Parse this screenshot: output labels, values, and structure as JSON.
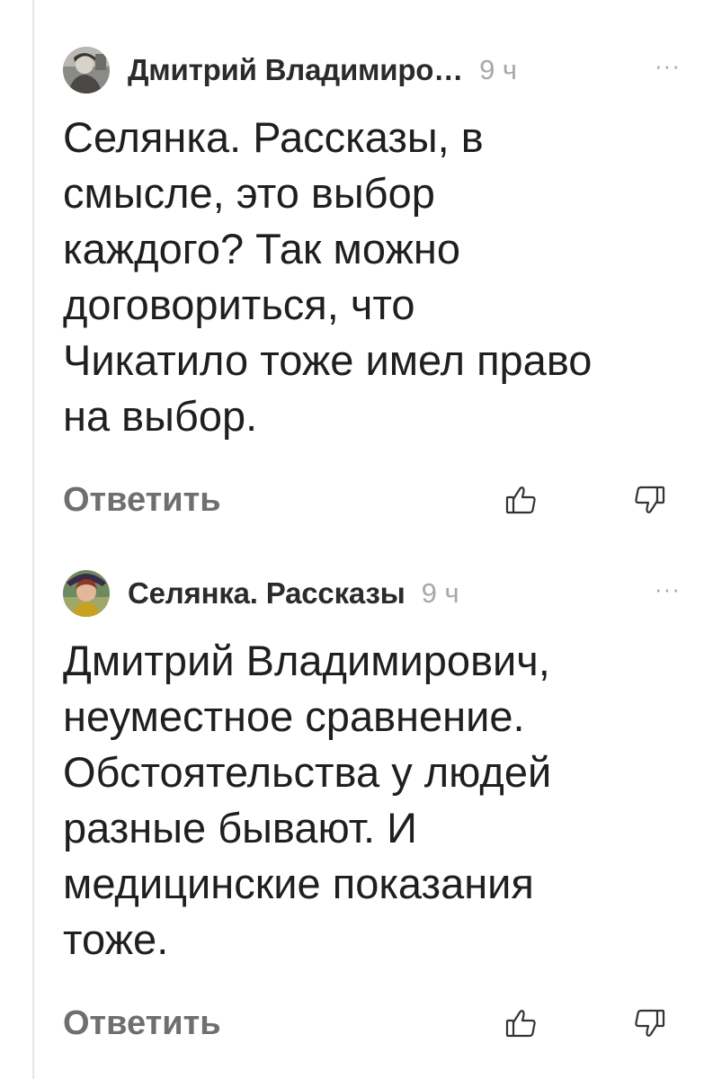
{
  "comments": [
    {
      "author": "Дмитрий Владимиро…",
      "time": "9 ч",
      "text": "Селянка. Рассказы, в\nсмысле, это выбор\nкаждого? Так можно\nдоговориться, что\nЧикатило тоже имел право\nна выбор.",
      "more_label": "···",
      "reply_label": "Ответить",
      "like_icon": "thumb-up-icon",
      "dislike_icon": "thumb-down-icon"
    },
    {
      "author": "Селянка. Рассказы",
      "time": "9 ч",
      "text": "Дмитрий Владимирович,\nнеуместное сравнение.\nОбстоятельства у людей\nразные бывают. И\nмедицинские показания\nтоже.",
      "more_label": "···",
      "reply_label": "Ответить",
      "like_icon": "thumb-up-icon",
      "dislike_icon": "thumb-down-icon"
    }
  ],
  "colors": {
    "text": "#1f1f1f",
    "muted": "#a8a8a8",
    "reply": "#6f6f6f",
    "thread_line": "#e6e6e6"
  }
}
